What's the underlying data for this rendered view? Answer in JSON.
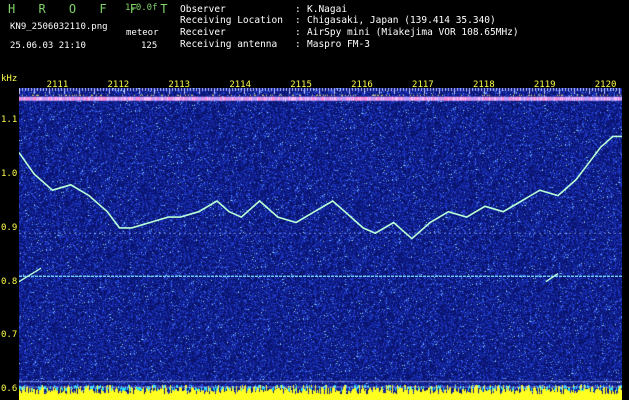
{
  "header": {
    "app_logo": "H R O F F T",
    "version": "1.0.0f",
    "filename": "KN9_2506032110.png",
    "program": "meteor",
    "datetime": "25.06.03 21:10",
    "count": "125",
    "info": [
      {
        "key": "Observer",
        "value": "K.Nagai"
      },
      {
        "key": "Receiving Location",
        "value": "Chigasaki, Japan (139.414 35.340)"
      },
      {
        "key": "Receiver",
        "value": "AirSpy mini (Miakejima VOR 108.65MHz)"
      },
      {
        "key": "Receiving antenna",
        "value": "Maspro FM-3"
      }
    ]
  },
  "colors": {
    "background": "#000000",
    "plot_noise": "#1c2a9a",
    "text_green": "#7fd36a",
    "text_yellow": "#ffff4a",
    "trace": "#b8ffd6"
  },
  "chart_data": {
    "type": "line",
    "ylabel": "kHz",
    "y_ticks": [
      "1.1",
      "1.0",
      "0.9",
      "0.8",
      "0.7",
      "0.6"
    ],
    "x_ticks": [
      "2111",
      "2112",
      "2113",
      "2114",
      "2115",
      "2116",
      "2117",
      "2118",
      "2119",
      "2120"
    ],
    "ylim": [
      0.58,
      1.16
    ],
    "xlim": [
      2110.35,
      2120.25
    ],
    "series": [
      {
        "x": [
          2110.35,
          2110.6,
          2110.9,
          2111.2,
          2111.5,
          2111.8,
          2112.0,
          2112.2,
          2112.5,
          2112.8,
          2113.0,
          2113.3,
          2113.6,
          2113.8,
          2114.0,
          2114.3,
          2114.6,
          2114.9,
          2115.2,
          2115.5,
          2115.8,
          2116.0,
          2116.2,
          2116.5,
          2116.8,
          2117.1,
          2117.4,
          2117.7,
          2118.0,
          2118.3,
          2118.6,
          2118.9,
          2119.2,
          2119.5,
          2119.7,
          2119.9,
          2120.1,
          2120.25
        ],
        "values": [
          1.04,
          1.0,
          0.97,
          0.98,
          0.96,
          0.93,
          0.9,
          0.9,
          0.91,
          0.92,
          0.92,
          0.93,
          0.95,
          0.93,
          0.92,
          0.95,
          0.92,
          0.91,
          0.93,
          0.95,
          0.92,
          0.9,
          0.89,
          0.91,
          0.88,
          0.91,
          0.93,
          0.92,
          0.94,
          0.93,
          0.95,
          0.97,
          0.96,
          0.99,
          1.02,
          1.05,
          1.07,
          1.07
        ]
      }
    ],
    "reference_lines_khz": [
      0.81,
      0.89
    ]
  }
}
